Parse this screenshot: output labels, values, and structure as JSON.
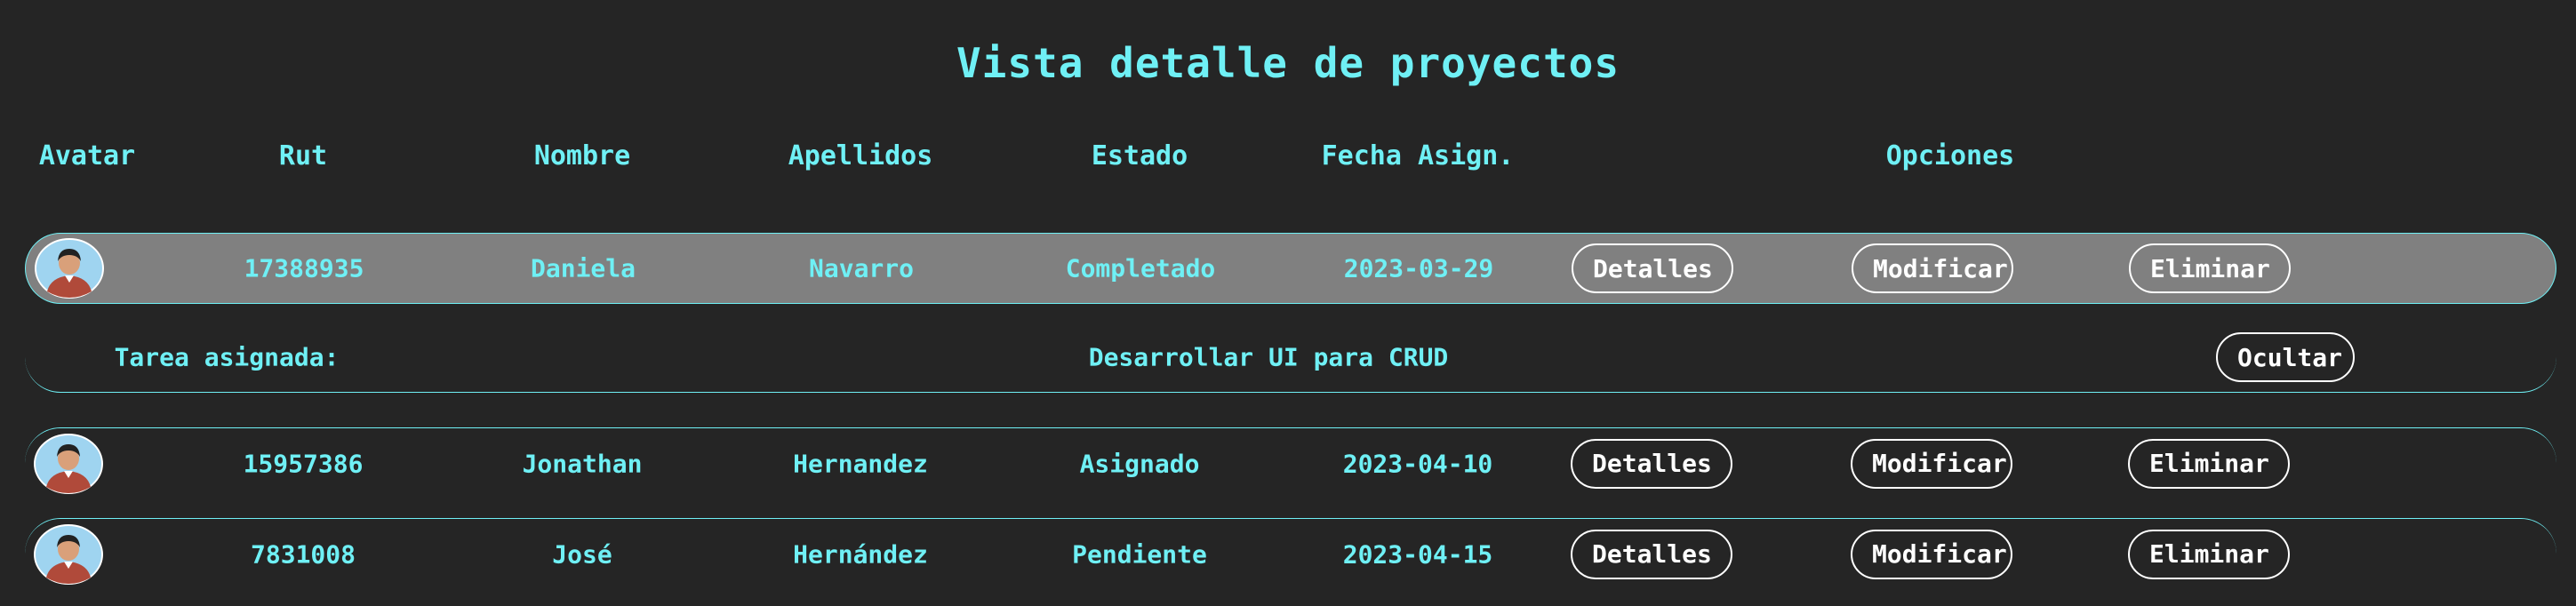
{
  "title": "Vista detalle de proyectos",
  "columns": {
    "avatar": "Avatar",
    "rut": "Rut",
    "nombre": "Nombre",
    "apellidos": "Apellidos",
    "estado": "Estado",
    "fecha": "Fecha Asign.",
    "opciones": "Opciones"
  },
  "rows": [
    {
      "rut": "17388935",
      "nombre": "Daniela",
      "apellidos": "Navarro",
      "estado": "Completado",
      "fecha": "2023-03-29",
      "expanded": true
    },
    {
      "rut": "15957386",
      "nombre": "Jonathan",
      "apellidos": "Hernandez",
      "estado": "Asignado",
      "fecha": "2023-04-10",
      "expanded": false
    },
    {
      "rut": "7831008",
      "nombre": "José",
      "apellidos": "Hernández",
      "estado": "Pendiente",
      "fecha": "2023-04-15",
      "expanded": false
    }
  ],
  "buttons": {
    "details": "Detalles",
    "modify": "Modificar",
    "delete": "Eliminar",
    "hide": "Ocultar"
  },
  "detail": {
    "label": "Tarea asignada:",
    "task": "Desarrollar UI para CRUD"
  },
  "colors": {
    "background": "#252525",
    "accent": "#6ff0f5",
    "selected_row": "#808080",
    "button_text": "#ffffff"
  },
  "icons": {
    "avatar": "person-avatar-icon"
  }
}
